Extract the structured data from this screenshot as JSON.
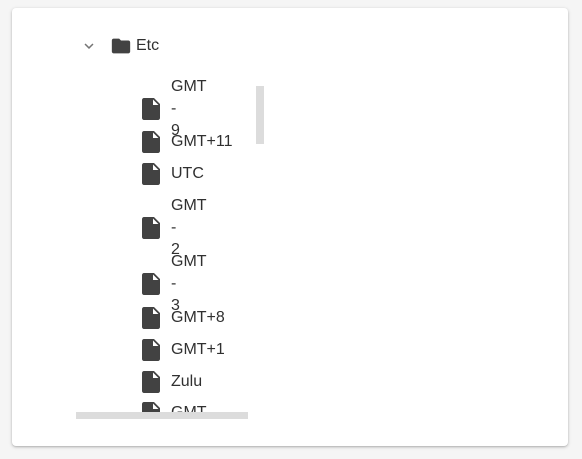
{
  "tree": {
    "root": {
      "label": "Etc",
      "expanded": true
    },
    "items": [
      {
        "line1": "GMT-",
        "line2": "9"
      },
      {
        "line1": "GMT+11",
        "line2": ""
      },
      {
        "line1": "UTC",
        "line2": ""
      },
      {
        "line1": "GMT-",
        "line2": "2"
      },
      {
        "line1": "GMT-",
        "line2": "3"
      },
      {
        "line1": "GMT+8",
        "line2": ""
      },
      {
        "line1": "GMT+1",
        "line2": ""
      },
      {
        "line1": "Zulu",
        "line2": ""
      },
      {
        "line1": "GMT-",
        "line2": ""
      }
    ]
  },
  "icons": {
    "chevron": "chevron-down-icon",
    "folder": "folder-icon",
    "file": "file-icon"
  },
  "colors": {
    "icon": "#424242",
    "text": "#303030",
    "scrollbar": "#dcdcdc",
    "background": "#ffffff"
  }
}
